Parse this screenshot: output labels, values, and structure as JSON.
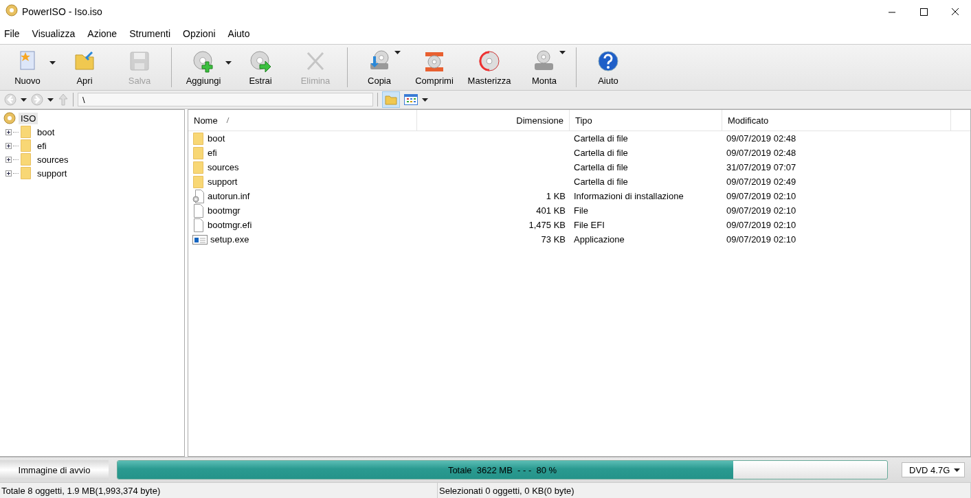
{
  "window": {
    "title": "PowerISO - Iso.iso"
  },
  "menu": [
    "File",
    "Visualizza",
    "Azione",
    "Strumenti",
    "Opzioni",
    "Aiuto"
  ],
  "toolbar": [
    [
      {
        "label": "Nuovo",
        "disabled": false,
        "kind": "split"
      },
      {
        "label": "Apri",
        "disabled": false,
        "kind": "plain"
      },
      {
        "label": "Salva",
        "disabled": true,
        "kind": "plain"
      }
    ],
    [
      {
        "label": "Aggiungi",
        "disabled": false,
        "kind": "split"
      },
      {
        "label": "Estrai",
        "disabled": false,
        "kind": "plain"
      },
      {
        "label": "Elimina",
        "disabled": true,
        "kind": "plain"
      }
    ],
    [
      {
        "label": "Copia",
        "disabled": false,
        "kind": "menu"
      },
      {
        "label": "Comprimi",
        "disabled": false,
        "kind": "plain"
      },
      {
        "label": "Masterizza",
        "disabled": false,
        "kind": "plain"
      },
      {
        "label": "Monta",
        "disabled": false,
        "kind": "menu"
      }
    ],
    [
      {
        "label": "Aiuto",
        "disabled": false,
        "kind": "plain"
      }
    ]
  ],
  "address": {
    "value": "\\",
    "folders_pane": {
      "selected": true
    }
  },
  "tree": {
    "label": "ISO",
    "selected": true,
    "children": [
      {
        "label": "boot",
        "selected": false,
        "expanded": false
      },
      {
        "label": "efi",
        "selected": false,
        "expanded": false
      },
      {
        "label": "sources",
        "selected": false,
        "expanded": false
      },
      {
        "label": "support",
        "selected": false,
        "expanded": false
      }
    ]
  },
  "table": {
    "columns": [
      {
        "label": "Nome",
        "sorted": true
      },
      {
        "label": "Dimensione",
        "sorted": false
      },
      {
        "label": "Tipo",
        "sorted": false
      },
      {
        "label": "Modificato",
        "sorted": false
      }
    ],
    "rows": [
      {
        "kind": "folder",
        "name": "boot",
        "type": "Cartella di file",
        "modified": "09/07/2019 02:48"
      },
      {
        "kind": "folder",
        "name": "efi",
        "type": "Cartella di file",
        "modified": "09/07/2019 02:48"
      },
      {
        "kind": "folder",
        "name": "sources",
        "type": "Cartella di file",
        "modified": "31/07/2019 07:07"
      },
      {
        "kind": "folder",
        "name": "support",
        "type": "Cartella di file",
        "modified": "09/07/2019 02:49"
      },
      {
        "kind": "settings",
        "name": "autorun.inf",
        "size": "1 KB",
        "type": "Informazioni di installazione",
        "modified": "09/07/2019 02:10"
      },
      {
        "kind": "file",
        "name": "bootmgr",
        "size": "401 KB",
        "type": "File",
        "modified": "09/07/2019 02:10"
      },
      {
        "kind": "file",
        "name": "bootmgr.efi",
        "size": "1,475 KB",
        "type": "File EFI",
        "modified": "09/07/2019 02:10"
      },
      {
        "kind": "app",
        "name": "setup.exe",
        "size": "73 KB",
        "type": "Applicazione",
        "modified": "09/07/2019 02:10"
      }
    ]
  },
  "capacity": {
    "boot_button": "Immagine di avvio",
    "text": "Totale  3622 MB  - - -  80 %",
    "level": 0.8,
    "media": "DVD 4.7G"
  },
  "status_bar": [
    "Totale 8 oggetti, 1.9 MB(1,993,374 byte)",
    "Selezionati 0 oggetti, 0 KB(0 byte)"
  ]
}
